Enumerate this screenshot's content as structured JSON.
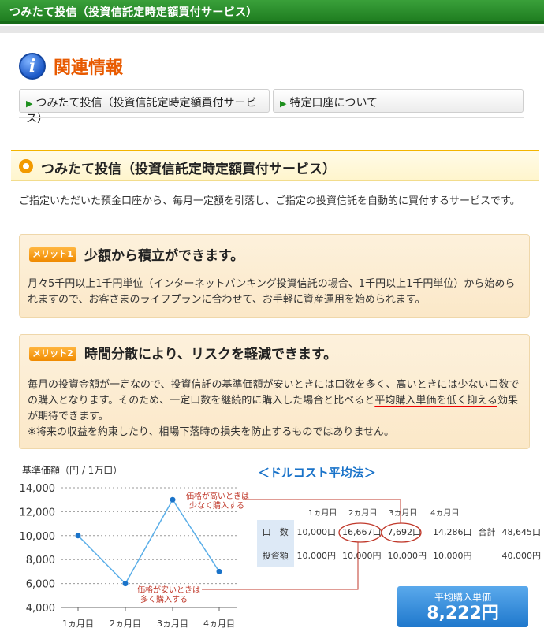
{
  "header": {
    "title": "つみたて投信（投資信託定時定額買付サービス）"
  },
  "related": {
    "heading": "関連情報",
    "links": [
      "つみたて投信（投資信託定時定額買付サービス）",
      "特定口座について"
    ]
  },
  "section": {
    "title": "つみたて投信（投資信託定時定額買付サービス）",
    "intro": "ご指定いただいた預金口座から、毎月一定額を引落し、ご指定の投資信託を自動的に買付するサービスです。",
    "merit1": {
      "badge": "メリット1",
      "title": "少額から積立ができます。",
      "body": "月々5千円以上1千円単位（インターネットバンキング投資信託の場合、1千円以上1千円単位）から始められますので、お客さまのライフプランに合わせて、お手軽に資産運用を始められます。"
    },
    "merit2": {
      "badge": "メリット2",
      "title": "時間分散により、リスクを軽減できます。",
      "body_pre": "毎月の投資金額が一定なので、投資信託の基準価額が安いときには口数を多く、高いときには少ない口数での購入となります。そのため、一定口数を継続的に購入した場合と比べると",
      "body_ul": "平均購入単価を低く抑える",
      "body_post": "効果が期待できます。",
      "note": "※将来の収益を約束したり、相場下落時の損失を防止するものではありません。"
    }
  },
  "chart_data": {
    "type": "line",
    "title": "",
    "ylabel": "基準価額（円 / 1万口）",
    "xlabel": "",
    "categories": [
      "1ヵ月目",
      "2ヵ月目",
      "3ヵ月目",
      "4ヵ月目"
    ],
    "series": [
      {
        "values": [
          10000,
          6000,
          13000,
          7000
        ]
      }
    ],
    "ylim": [
      4000,
      14000
    ],
    "yticks": [
      "4,000",
      "6,000",
      "8,000",
      "10,000",
      "12,000",
      "14,000"
    ],
    "grid": true,
    "color": "#5aaee8",
    "annotations": [
      "価格が高いときは",
      "少なく購入する",
      "価格が安いときは",
      "多く購入する"
    ]
  },
  "dca": {
    "title": "＜ドルコスト平均法＞",
    "headers": [
      "1ヵ月目",
      "2ヵ月目",
      "3ヵ月目",
      "4ヵ月目"
    ],
    "rows": [
      {
        "label": "口　数",
        "cells": [
          "10,000口",
          "16,667口",
          "7,692口",
          "14,286口"
        ],
        "total_label": "合計",
        "total": "48,645口"
      },
      {
        "label": "投資額",
        "cells": [
          "10,000円",
          "10,000円",
          "10,000円",
          "10,000円"
        ],
        "total_label": "",
        "total": "40,000円"
      }
    ],
    "avg_label": "平均購入単価",
    "avg_value": "8,222円"
  }
}
